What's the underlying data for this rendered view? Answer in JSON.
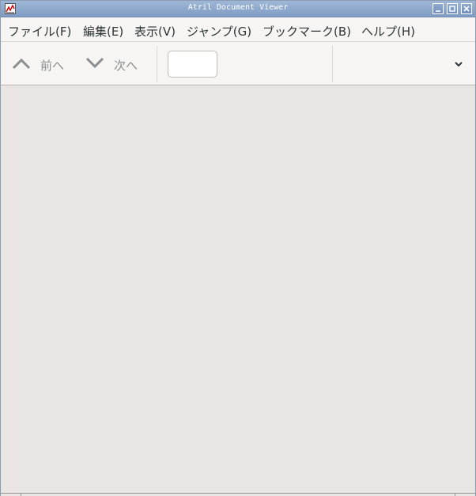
{
  "window": {
    "title": "Atril Document Viewer"
  },
  "menu": {
    "items": [
      {
        "label": "ファイル(F)"
      },
      {
        "label": "編集(E)"
      },
      {
        "label": "表示(V)"
      },
      {
        "label": "ジャンプ(G)"
      },
      {
        "label": "ブックマーク(B)"
      },
      {
        "label": "ヘルプ(H)"
      }
    ]
  },
  "toolbar": {
    "prev_label": "前へ",
    "next_label": "次へ",
    "page_entry_value": ""
  },
  "colors": {
    "titlebar": "#8aa6cc",
    "menubar": "#f6f5f4",
    "document_background": "#e8e5e2",
    "disabled_text": "#8b8e8f"
  },
  "icons": {
    "app": "atril-app-icon",
    "prev": "chevron-up-icon",
    "next": "chevron-down-icon",
    "more": "chevron-down-icon"
  }
}
